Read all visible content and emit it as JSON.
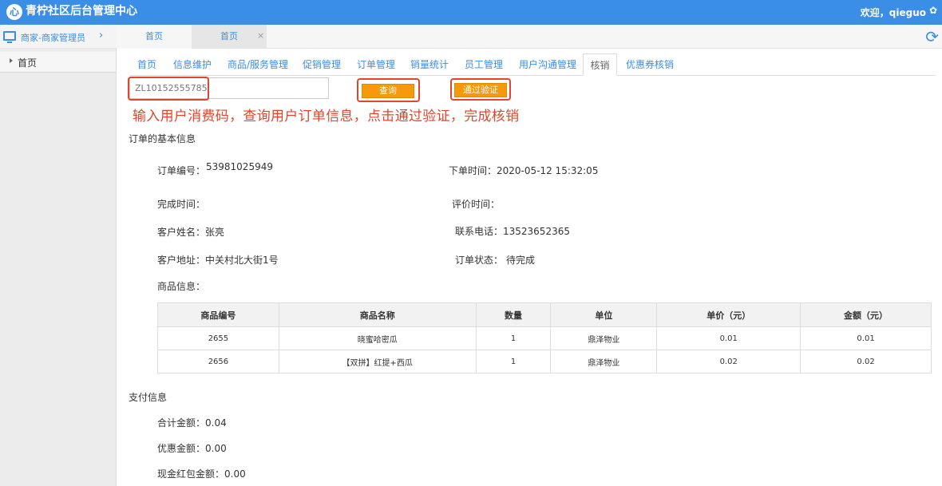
{
  "header": {
    "logo_glyph": "⼼",
    "title": "青柠社区后台管理中心",
    "welcome": "欢迎，qieguo"
  },
  "sidebar": {
    "role": "商家-商家管理员",
    "items": [
      {
        "label": "首页"
      }
    ]
  },
  "page_tabs": [
    {
      "label": "首页"
    },
    {
      "label": "首页"
    }
  ],
  "sub_nav": {
    "items": [
      {
        "label": "首页"
      },
      {
        "label": "信息维护"
      },
      {
        "label": "商品/服务管理"
      },
      {
        "label": "促销管理"
      },
      {
        "label": "订单管理"
      },
      {
        "label": "销量统计"
      },
      {
        "label": "员工管理"
      },
      {
        "label": "用户沟通管理"
      },
      {
        "label": "核销"
      },
      {
        "label": "优惠券核销"
      }
    ],
    "active_index": 8
  },
  "search": {
    "value": "ZL10152555785",
    "query_button": "查询",
    "verify_button": "通过验证"
  },
  "instruction": "输入用户消费码，查询用户订单信息，点击通过验证，完成核销",
  "order": {
    "section_title": "订单的基本信息",
    "order_no_label": "订单编号：",
    "order_no": "53981025949",
    "order_time": "下单时间：2020-05-12 15:32:05",
    "complete_time": "完成时间：",
    "review_time": "评价时间：",
    "customer_name": "客户姓名：张亮",
    "phone": "联系电话：13523652365",
    "address": "客户地址：中关村北大街1号",
    "status_label": "订单状态：",
    "status": "待完成",
    "goods_label": "商品信息："
  },
  "goods_table": {
    "headers": [
      "商品编号",
      "商品名称",
      "数量",
      "单位",
      "单价（元）",
      "金额（元）"
    ],
    "rows": [
      [
        "2655",
        "晓蜜哈密瓜",
        "1",
        "鼎泽物业",
        "0.01",
        "0.01"
      ],
      [
        "2656",
        "【双拼】红提+西瓜",
        "1",
        "鼎泽物业",
        "0.02",
        "0.02"
      ]
    ]
  },
  "payment": {
    "section_title": "支付信息",
    "total": "合计金额：0.04",
    "discount": "优惠金额：0.00",
    "red_packet": "现金红包金额：0.00"
  },
  "icons": {
    "logo": "logo-icon",
    "settings": "gear-icon",
    "monitor": "monitor-icon",
    "chevron": "chevron-right-icon",
    "refresh": "refresh-icon",
    "close": "close-icon",
    "tree": "triangle-right-icon"
  },
  "colors": {
    "brand": "#3a8ee6",
    "button": "#f59a0a",
    "highlight": "#e0462b"
  }
}
